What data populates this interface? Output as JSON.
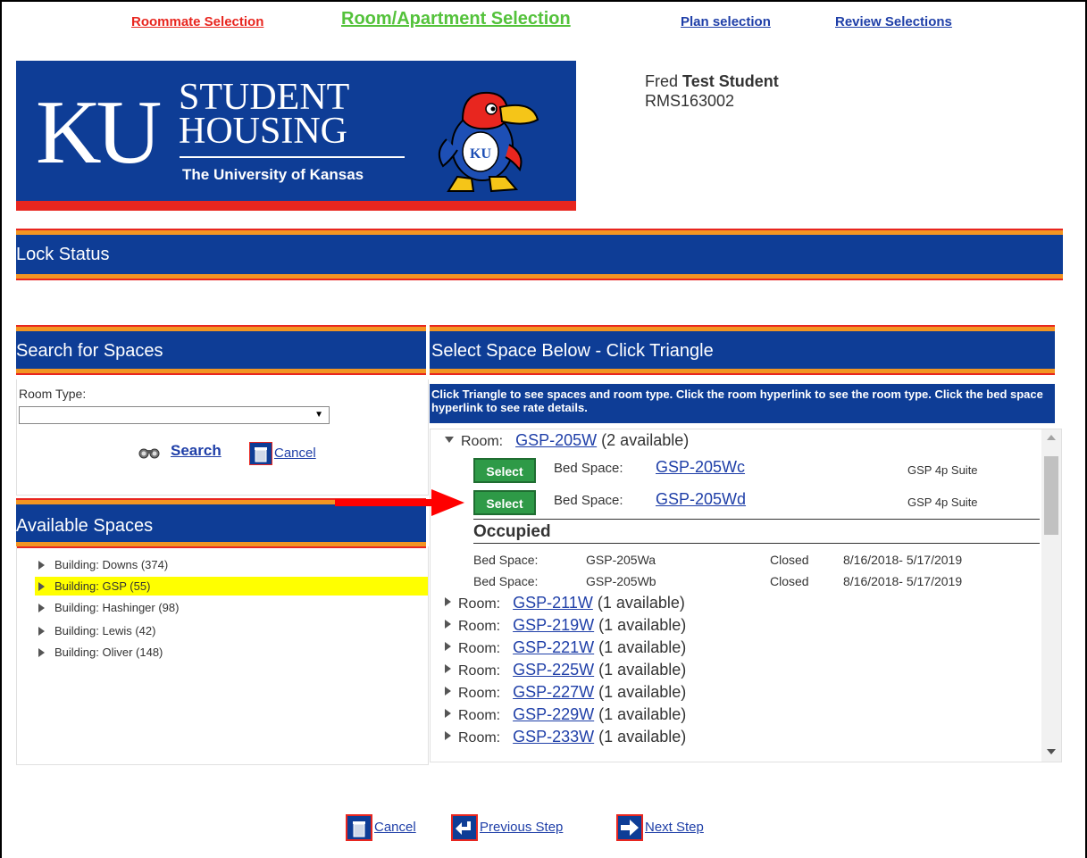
{
  "nav": {
    "roommate": "Roommate Selection",
    "room": "Room/Apartment Selection",
    "plan": "Plan selection",
    "review": "Review Selections"
  },
  "banner": {
    "letters": "KU",
    "line1": "STUDENT",
    "line2": "HOUSING",
    "university": "The University of Kansas"
  },
  "student": {
    "first_name": "Fred",
    "last_name": "Test Student",
    "id": "RMS163002"
  },
  "lock_status": {
    "title": "Lock Status"
  },
  "search": {
    "title": "Search for Spaces",
    "room_type_label": "Room Type:",
    "room_type_value": "",
    "search_label": "Search",
    "cancel_label": "Cancel"
  },
  "available": {
    "title": "Available Spaces",
    "buildings": [
      "Building: Downs (374)",
      "Building: GSP (55)",
      "Building: Hashinger (98)",
      "Building: Lewis (42)",
      "Building: Oliver (148)"
    ]
  },
  "select_space": {
    "title": "Select Space Below - Click Triangle",
    "instructions": "Click Triangle to see spaces and room type. Click the room hyperlink to see the room type. Click the bed space hyperlink to see rate details.",
    "room_word": "Room:",
    "bed_space_label": "Bed Space:",
    "select_label": "Select",
    "expanded_room": {
      "id": "GSP-205W",
      "avail": "(2 available)"
    },
    "bed_spaces": [
      {
        "id": "GSP-205Wc",
        "type": "GSP 4p Suite"
      },
      {
        "id": "GSP-205Wd",
        "type": "GSP 4p Suite"
      }
    ],
    "occupied_title": "Occupied",
    "occupied": [
      {
        "label": "Bed Space:",
        "id": "GSP-205Wa",
        "status": "Closed",
        "dates": "8/16/2018- 5/17/2019"
      },
      {
        "label": "Bed Space:",
        "id": "GSP-205Wb",
        "status": "Closed",
        "dates": "8/16/2018- 5/17/2019"
      }
    ],
    "rooms": [
      {
        "id": "GSP-211W",
        "avail": "(1 available)"
      },
      {
        "id": "GSP-219W",
        "avail": "(1 available)"
      },
      {
        "id": "GSP-221W",
        "avail": "(1 available)"
      },
      {
        "id": "GSP-225W",
        "avail": "(1 available)"
      },
      {
        "id": "GSP-227W",
        "avail": "(1 available)"
      },
      {
        "id": "GSP-229W",
        "avail": "(1 available)"
      },
      {
        "id": "GSP-233W",
        "avail": "(1 available)"
      }
    ]
  },
  "bottom": {
    "cancel": "Cancel",
    "previous": "Previous Step",
    "next": "Next Step"
  },
  "colors": {
    "ku_blue": "#0e3d96",
    "ku_red": "#e8261f",
    "accent_orange": "#f29522",
    "select_green": "#2e9a47",
    "highlight_yellow": "#ffff00"
  }
}
